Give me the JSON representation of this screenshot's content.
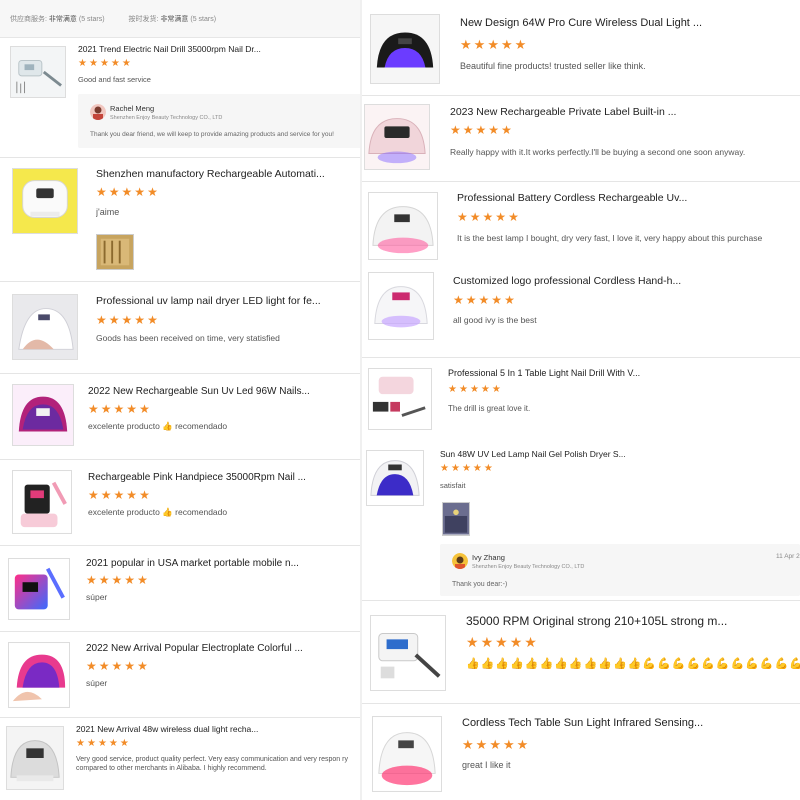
{
  "summary": {
    "supplier_service_label": "供应商服务:",
    "supplier_service_value": "非常满意",
    "supplier_service_stars": "(5 stars)",
    "on_time_label": "按时发货:",
    "on_time_value": "非常满意",
    "on_time_stars": "(5 stars)"
  },
  "star_char": "★",
  "accent_color": "#f28c28",
  "left_reviews": [
    {
      "title": "2021 Trend Electric Nail Drill 35000rpm Nail Dr...",
      "comment": "Good and fast service",
      "thumb": "nail-drill-white"
    },
    {
      "title": "Shenzhen manufactory Rechargeable Automati...",
      "comment": "j'aime",
      "thumb": "uv-lamp-white"
    },
    {
      "title": "Professional uv lamp nail dryer LED light for fe...",
      "comment": "Goods has been received on time, very statisfied",
      "thumb": "uv-lamp-hand"
    },
    {
      "title": "2022 New Rechargeable Sun Uv Led 96W Nails...",
      "comment": "excelente producto 👍 recomendado",
      "thumb": "uv-lamp-pink"
    },
    {
      "title": "Rechargeable Pink Handpiece 35000Rpm Nail ...",
      "comment": "excelente producto 👍 recomendado",
      "thumb": "nail-drill-pink"
    },
    {
      "title": "2021 popular in USA market portable mobile n...",
      "comment": "súper",
      "thumb": "nail-drill-gradient"
    },
    {
      "title": "2022 New Arrival Popular Electroplate Colorful ...",
      "comment": "súper",
      "thumb": "uv-lamp-electroplate"
    },
    {
      "title": "2021 New Arrival 48w wireless dual light recha...",
      "comment": "Very good service, product quality perfect. Very easy communication and very respon ry compared to other merchants in Alibaba. I highly recommend.",
      "thumb": "uv-lamp-silver"
    }
  ],
  "left_reply": {
    "name": "Rachel Meng",
    "company": "Shenzhen Enjoy Beauty Technology CO., LTD",
    "message": "Thank you dear friend, we will keep to provide amazing products and service for you!"
  },
  "right_reviews": [
    {
      "title": "New Design 64W Pro Cure Wireless Dual Light ...",
      "comment": "Beautiful fine products! trusted seller like think.",
      "thumb": "uv-lamp-black"
    },
    {
      "title": "2023 New Rechargeable Private Label Built-in ...",
      "comment": "Really happy with it.It works perfectly.I'll be buying a second one soon anyway.",
      "thumb": "uv-lamp-rose"
    },
    {
      "title": "Professional Battery Cordless Rechargeable Uv...",
      "comment": "It is the best lamp I bought, dry very fast, I love it, very happy about this purchase",
      "thumb": "uv-lamp-glow"
    },
    {
      "title": "Customized logo professional Cordless Hand-h...",
      "comment": "all good ivy is the best",
      "thumb": "uv-lamp-round"
    },
    {
      "title": "Professional 5 In 1 Table Light Nail Drill With V...",
      "comment": "The drill is great love it.",
      "thumb": "nail-drill-set"
    },
    {
      "title": "Sun 48W UV Led Lamp Nail Gel Polish Dryer S...",
      "comment": "satisfait",
      "thumb": "uv-lamp-purple"
    },
    {
      "title": "35000 RPM Original strong 210+105L strong m...",
      "comment": "👍👍👍👍👍👍👍👍👍👍👍👍💪💪💪💪💪💪💪💪💪💪💪💪💪💪🌹🌹🌹",
      "thumb": "nail-drill-strong"
    },
    {
      "title": "Cordless Tech Table Sun Light Infrared Sensing...",
      "comment": "great I like it",
      "thumb": "uv-lamp-red"
    }
  ],
  "right_reply": {
    "name": "Ivy Zhang",
    "company": "Shenzhen Enjoy Beauty Technology CO., LTD",
    "message": "Thank you dear:-)",
    "date": "11 Apr 2"
  }
}
